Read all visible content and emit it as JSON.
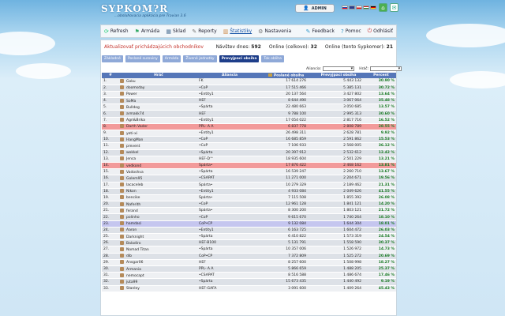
{
  "app": {
    "logo": "SYPKOM?R",
    "tagline": "...obsluhovacia aplikácia pre Travian 3.6"
  },
  "header": {
    "user_label": "ADMIN"
  },
  "nav": {
    "refresh": "Refresh",
    "army": "Armáda",
    "storage": "Sklad",
    "reports": "Reporty",
    "stats": "Štatistiky",
    "settings": "Nastavenia",
    "feedback": "Feedback",
    "help": "Pomoc",
    "logout": "Odhlásiť"
  },
  "page": {
    "update_link": "Aktualizovať prichádzajúcich obchodníkov",
    "visits_label": "Návštev dnes:",
    "visits_value": "592",
    "online_total_label": "Online (celkovo):",
    "online_total_value": "32",
    "online_here_label": "Online (tento Sypkomer):",
    "online_here_value": "21"
  },
  "tabs": [
    "Základné",
    "Poslané suroviny",
    "Armáda",
    "Živené jednotky",
    "Prevyjpaci obsiha",
    "Tok obliha"
  ],
  "filters": {
    "alliance_label": "Aliancia:",
    "player_label": "Hráč:"
  },
  "table": {
    "headers": {
      "idx": "#",
      "player": "Hráč",
      "alliance": "Aliancia",
      "sent": "Poslané obsiha",
      "received": "Prevyjpaci obsiha",
      "percent": "Percent"
    },
    "rows": [
      [
        "1.",
        "Goku",
        "FK",
        "17 614 276",
        "5 443 132",
        "30.90 %"
      ],
      [
        "2.",
        "doomsday",
        "•CoP",
        "17 515 466",
        "5 385 131",
        "30.72 %"
      ],
      [
        "3.",
        "Power",
        "•Entity1",
        "20 137 564",
        "3 427 802",
        "13.64 %"
      ],
      [
        "4.",
        "SoMa",
        "HEF",
        "8 644 490",
        "3 067 064",
        "35.48 %"
      ],
      [
        "5.",
        "Bulldog",
        "•Spárta",
        "22 480 663",
        "3 050 685",
        "13.57 %"
      ],
      [
        "6.",
        "armakk74",
        "HEF",
        "9 788 100",
        "2 995 313",
        "30.60 %"
      ],
      [
        "7.",
        "Agri&Brika",
        "•Entity1",
        "17 054 022",
        "2 817 716",
        "16.52 %"
      ],
      [
        "8.",
        "Darth Vader",
        "PPL- A A",
        "6 837 778",
        "2 808 789",
        "28.55 %"
      ],
      [
        "9.",
        "yeti-xi",
        "•Entity1",
        "26 498 311",
        "2 628 781",
        "9.92 %"
      ],
      [
        "10.",
        "HangMan",
        "•CoP",
        "16 685 859",
        "2 591 862",
        "15.53 %"
      ],
      [
        "11.",
        "prevent",
        "•CoP",
        "7 106 933",
        "2 568 005",
        "36.12 %"
      ],
      [
        "12.",
        "wokkel",
        "•Spárta",
        "20 397 912",
        "2 532 612",
        "12.42 %"
      ],
      [
        "13.",
        "Jenca",
        "HEF-D™",
        "18 935 604",
        "2 501 229",
        "13.21 %"
      ],
      [
        "14.",
        "vedkond",
        "Spárta•",
        "17 876 422",
        "2 468 162",
        "13.81 %"
      ],
      [
        "15.",
        "Vadoshva",
        "•Spárta",
        "16 539 247",
        "2 260 710",
        "13.67 %"
      ],
      [
        "16.",
        "Golem95",
        "•CSAPAT",
        "11 271 000",
        "2 204 671",
        "19.56 %"
      ],
      [
        "17.",
        "lacaceleb",
        "Spárta•",
        "10 279 329",
        "2 189 462",
        "21.31 %"
      ],
      [
        "18.",
        "Nikon",
        "•Entity1",
        "4 933 084",
        "2 049 626",
        "41.55 %"
      ],
      [
        "19.",
        "bencike",
        "Spárta•",
        "7 115 508",
        "1 855 392",
        "26.08 %"
      ],
      [
        "20.",
        "Naferith",
        "•CoP",
        "12 961 128",
        "1 841 121",
        "14.20 %"
      ],
      [
        "21.",
        "ferand",
        "Spárta•",
        "8 300 200",
        "1 803 121",
        "21.72 %"
      ],
      [
        "22.",
        "polinho",
        "•CoP",
        "9 615 670",
        "1 740 264",
        "18.10 %"
      ],
      [
        "23.",
        "hamdaci",
        "CoP•CP",
        "9 132 084",
        "1 644 304",
        "18.01 %"
      ],
      [
        "24.",
        "Aaron",
        "•Entity1",
        "6 163 725",
        "1 604 472",
        "26.03 %"
      ],
      [
        "25.",
        "Darknight",
        "•Spárta",
        "6 410 822",
        "1 573 319",
        "24.54 %"
      ],
      [
        "26.",
        "Baladiro",
        "HEF-B100",
        "5 131 791",
        "1 558 590",
        "30.37 %"
      ],
      [
        "27.",
        "Nomad Titan",
        "•Spárta",
        "10 357 006",
        "1 526 972",
        "14.73 %"
      ],
      [
        "28.",
        "dib",
        "CoP•CP",
        "7 372 809",
        "1 525 272",
        "20.69 %"
      ],
      [
        "29.",
        "Ansgar06",
        "HEF",
        "8 257 600",
        "1 508 998",
        "18.27 %"
      ],
      [
        "30.",
        "Armania",
        "PPL- A A",
        "5 866 659",
        "1 488 205",
        "25.37 %"
      ],
      [
        "31.",
        "nemocapt",
        "•CSAPAT",
        "8 516 588",
        "1 486 674",
        "17.46 %"
      ],
      [
        "32.",
        "juta99",
        "•Spárta",
        "15 673 435",
        "1 440 492",
        "9.19 %"
      ],
      [
        "33.",
        "Stanley",
        "HEF-GAFA",
        "3 091 600",
        "1 409 264",
        "45.43 %"
      ]
    ]
  }
}
